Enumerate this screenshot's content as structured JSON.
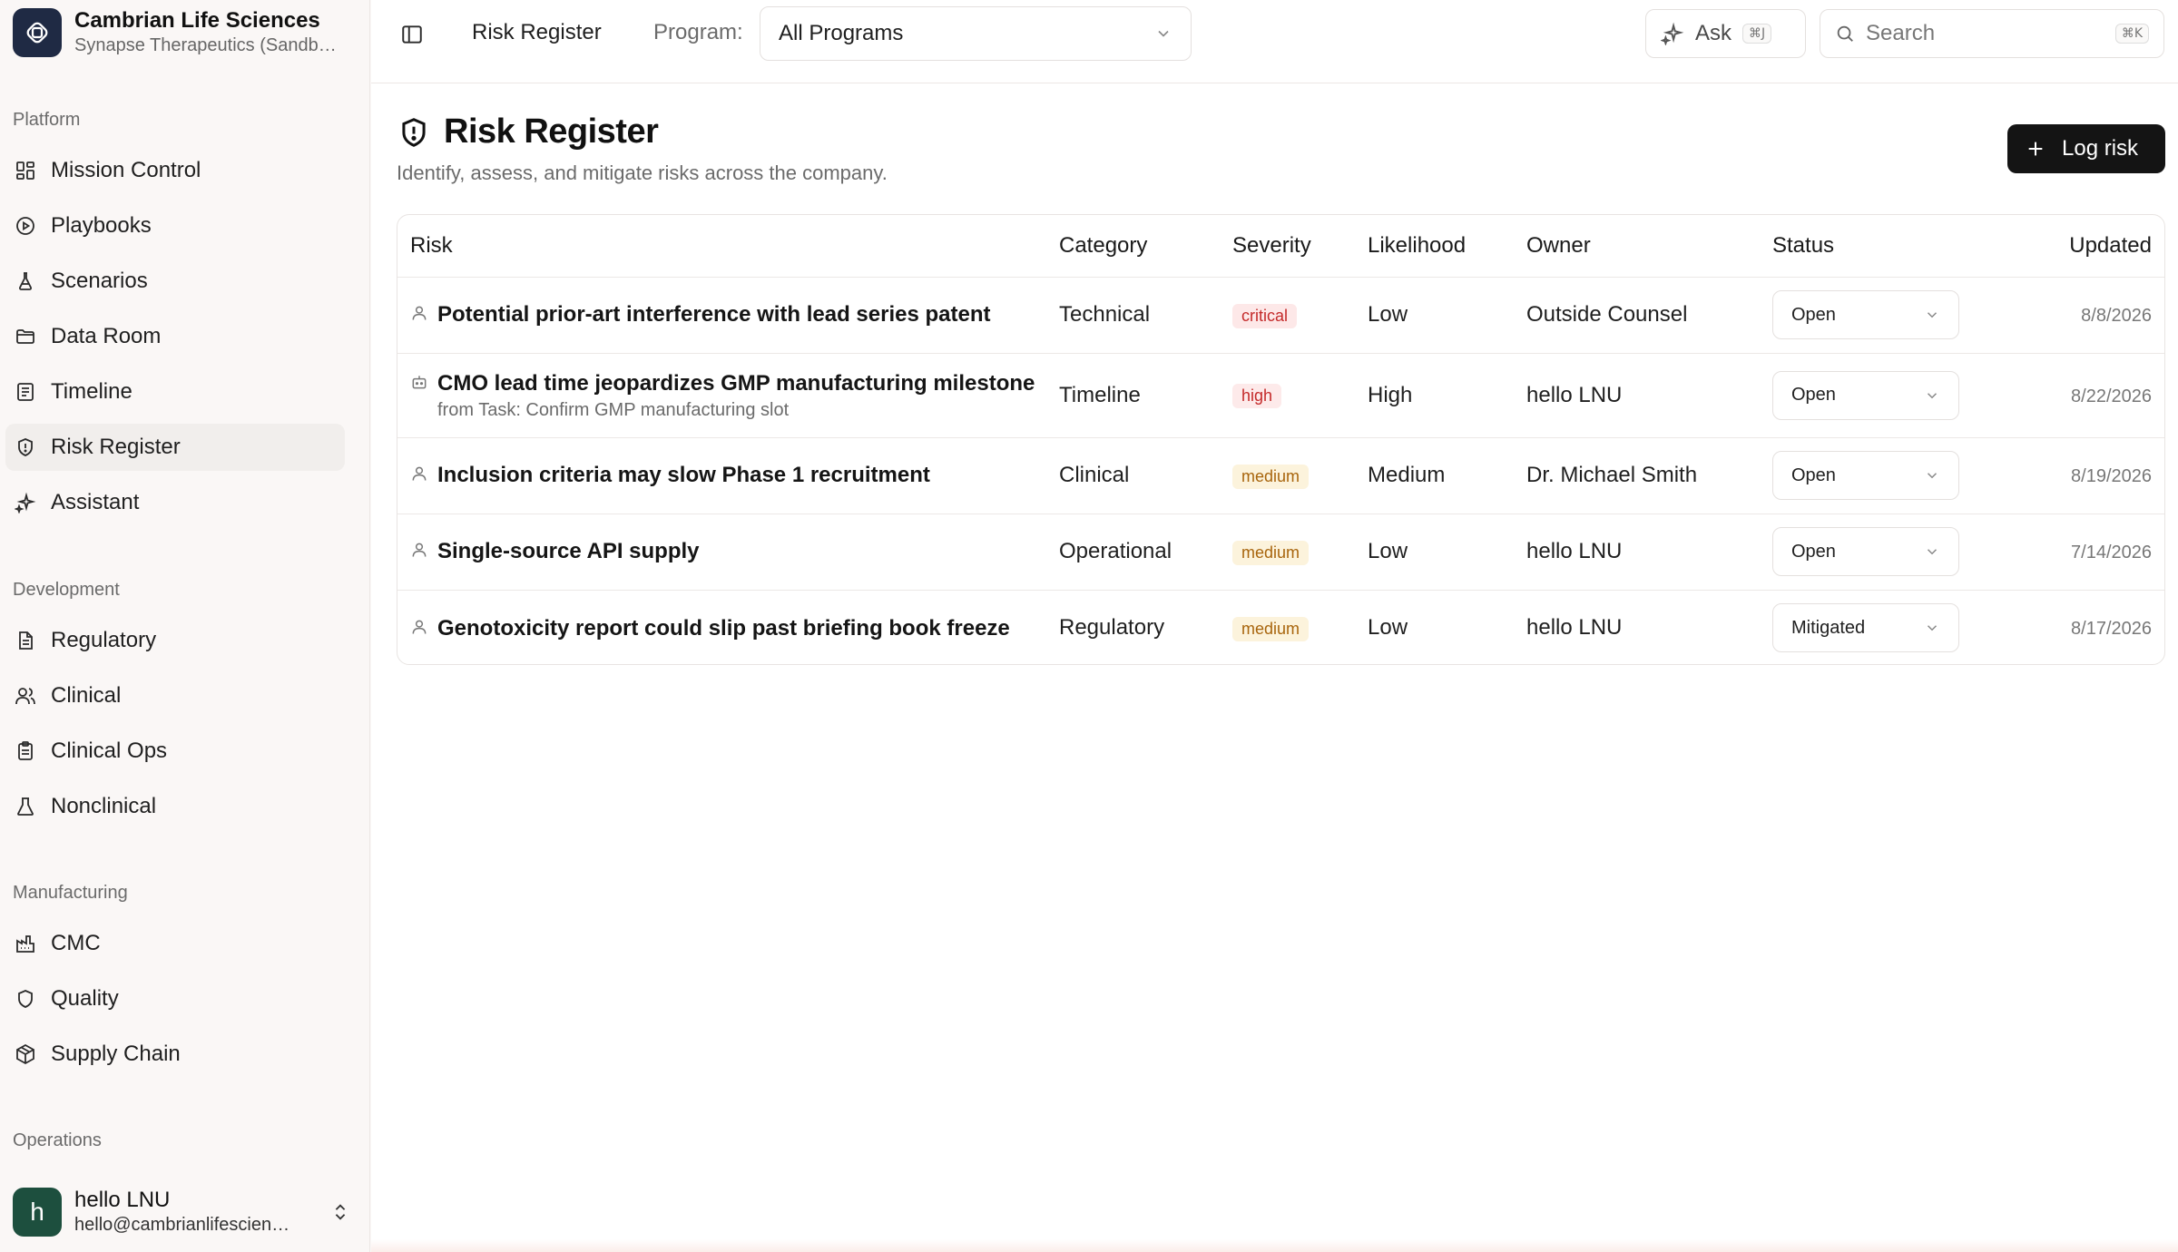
{
  "org": {
    "name": "Cambrian Life Sciences",
    "subtitle": "Synapse Therapeutics (Sandbox)"
  },
  "sidebar": {
    "sections": {
      "platform": "Platform",
      "development": "Development",
      "manufacturing": "Manufacturing",
      "operations": "Operations"
    },
    "platform_items": [
      {
        "label": "Mission Control",
        "icon": "dashboard-icon"
      },
      {
        "label": "Playbooks",
        "icon": "play-circle-icon"
      },
      {
        "label": "Scenarios",
        "icon": "flask-icon"
      },
      {
        "label": "Data Room",
        "icon": "folder-icon"
      },
      {
        "label": "Timeline",
        "icon": "list-icon"
      },
      {
        "label": "Risk Register",
        "icon": "shield-alert-icon"
      },
      {
        "label": "Assistant",
        "icon": "sparkles-icon"
      }
    ],
    "development_items": [
      {
        "label": "Regulatory",
        "icon": "document-icon"
      },
      {
        "label": "Clinical",
        "icon": "users-icon"
      },
      {
        "label": "Clinical Ops",
        "icon": "clipboard-icon"
      },
      {
        "label": "Nonclinical",
        "icon": "beaker-icon"
      }
    ],
    "manufacturing_items": [
      {
        "label": "CMC",
        "icon": "factory-icon"
      },
      {
        "label": "Quality",
        "icon": "shield-icon"
      },
      {
        "label": "Supply Chain",
        "icon": "package-icon"
      }
    ],
    "active": "Risk Register"
  },
  "user": {
    "initial": "h",
    "name": "hello LNU",
    "email": "hello@cambrianlifesciences.com"
  },
  "topbar": {
    "breadcrumb": "Risk Register",
    "program_label": "Program:",
    "program_value": "All Programs",
    "ask_label": "Ask",
    "ask_shortcut": "⌘J",
    "search_placeholder": "Search",
    "search_shortcut": "⌘K"
  },
  "page": {
    "title": "Risk Register",
    "subtitle": "Identify, assess, and mitigate risks across the company.",
    "log_button": "Log risk"
  },
  "table": {
    "headers": {
      "risk": "Risk",
      "category": "Category",
      "severity": "Severity",
      "likelihood": "Likelihood",
      "owner": "Owner",
      "status": "Status",
      "updated": "Updated"
    },
    "rows": [
      {
        "title": "Potential prior-art interference with lead series patent",
        "from": "",
        "category": "Technical",
        "severity": "critical",
        "likelihood": "Low",
        "owner": "Outside Counsel",
        "status": "Open",
        "updated": "8/8/2026",
        "icon": "person-icon"
      },
      {
        "title": "CMO lead time jeopardizes GMP manufacturing milestone",
        "from": "from Task: Confirm GMP manufacturing slot",
        "category": "Timeline",
        "severity": "high",
        "likelihood": "High",
        "owner": "hello LNU",
        "status": "Open",
        "updated": "8/22/2026",
        "icon": "bot-icon"
      },
      {
        "title": "Inclusion criteria may slow Phase 1 recruitment",
        "from": "",
        "category": "Clinical",
        "severity": "medium",
        "likelihood": "Medium",
        "owner": "Dr. Michael Smith",
        "status": "Open",
        "updated": "8/19/2026",
        "icon": "person-icon"
      },
      {
        "title": "Single-source API supply",
        "from": "",
        "category": "Operational",
        "severity": "medium",
        "likelihood": "Low",
        "owner": "hello LNU",
        "status": "Open",
        "updated": "7/14/2026",
        "icon": "person-icon"
      },
      {
        "title": "Genotoxicity report could slip past briefing book freeze",
        "from": "",
        "category": "Regulatory",
        "severity": "medium",
        "likelihood": "Low",
        "owner": "hello LNU",
        "status": "Mitigated",
        "updated": "8/17/2026",
        "icon": "person-icon"
      }
    ]
  },
  "colors": {
    "critical": "#c42a2a",
    "high": "#c42a2a",
    "medium": "#a8650d",
    "primary_button": "#141414",
    "avatar": "#1d4f3e",
    "org_logo": "#1f2a44"
  }
}
